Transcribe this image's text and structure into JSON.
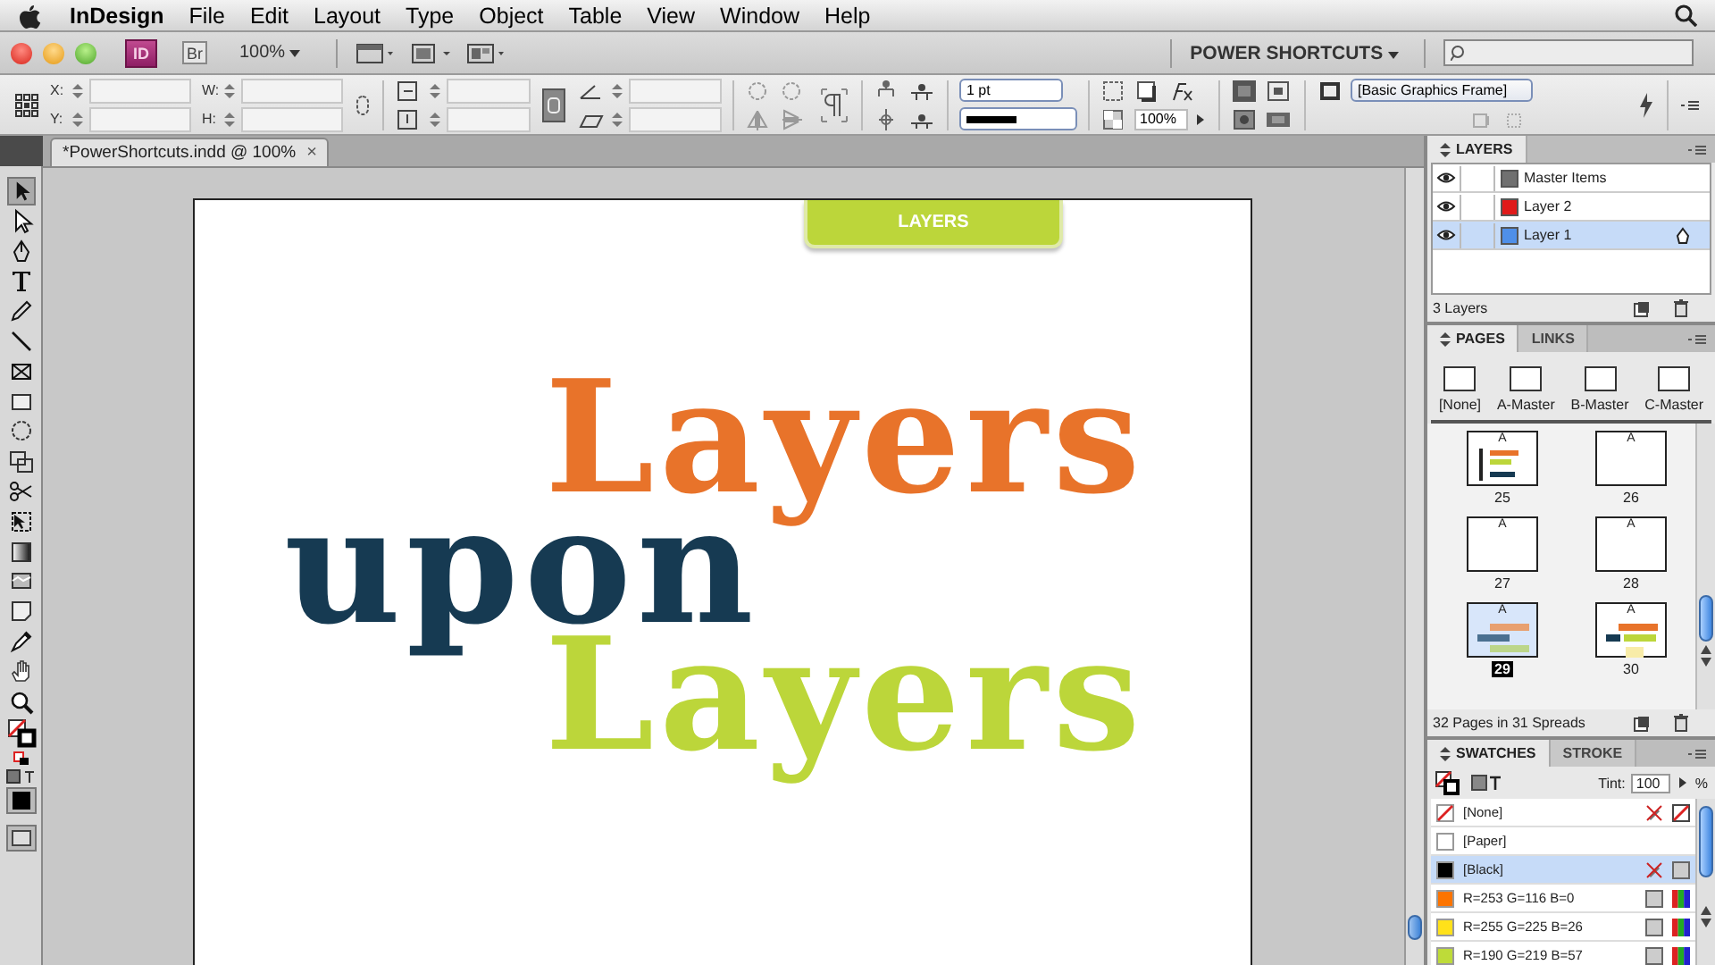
{
  "menu_bar": {
    "app": "InDesign",
    "items": [
      "File",
      "Edit",
      "Layout",
      "Type",
      "Object",
      "Table",
      "View",
      "Window",
      "Help"
    ]
  },
  "app_bar": {
    "app_badge": "ID",
    "bridge_button": "Br",
    "zoom": "100%",
    "workspace": "POWER SHORTCUTS"
  },
  "control_panel": {
    "labels": [
      "X:",
      "Y:",
      "W:",
      "H:"
    ],
    "stroke_weight": "1 pt",
    "opacity": "100%",
    "object_style": "[Basic Graphics Frame]"
  },
  "document_tab": {
    "title": "*PowerShortcuts.indd @ 100%",
    "close": "×"
  },
  "page": {
    "tab_label": "LAYERS",
    "lines": [
      {
        "text": "Layers",
        "color": "#e8732a"
      },
      {
        "text": "upon",
        "color": "#163a52"
      },
      {
        "text": "Layers",
        "color": "#bcd63a"
      }
    ]
  },
  "layers_panel": {
    "tabs": [
      {
        "label": "LAYERS",
        "selected": true
      }
    ],
    "layers": [
      {
        "name": "Master Items",
        "color": "#707070",
        "visible": true,
        "selected": false
      },
      {
        "name": "Layer 2",
        "color": "#e01a1a",
        "visible": true,
        "selected": false
      },
      {
        "name": "Layer 1",
        "color": "#4f8fe8",
        "visible": true,
        "selected": true
      }
    ],
    "footer": "3 Layers"
  },
  "pages_panel": {
    "tabs": [
      {
        "label": "PAGES",
        "selected": true
      },
      {
        "label": "LINKS",
        "selected": false
      }
    ],
    "masters": [
      "[None]",
      "A-Master",
      "B-Master",
      "C-Master"
    ],
    "pages": [
      {
        "number": "25",
        "master": "A",
        "kind": "collage",
        "selected": false
      },
      {
        "number": "26",
        "master": "A",
        "kind": "blank",
        "selected": false
      },
      {
        "number": "27",
        "master": "A",
        "kind": "blank",
        "selected": false
      },
      {
        "number": "28",
        "master": "A",
        "kind": "blank",
        "selected": false
      },
      {
        "number": "29",
        "master": "A",
        "kind": "layers",
        "selected": true
      },
      {
        "number": "30",
        "master": "A",
        "kind": "notes",
        "selected": false
      }
    ],
    "footer": "32 Pages in 31 Spreads"
  },
  "swatches_panel": {
    "tabs": [
      {
        "label": "SWATCHES",
        "selected": true
      },
      {
        "label": "STROKE",
        "selected": false
      }
    ],
    "tint_label": "Tint:",
    "tint": "100",
    "percent": "%",
    "swatches": [
      {
        "name": "[None]",
        "kind": "none",
        "locked": true,
        "selected": false
      },
      {
        "name": "[Paper]",
        "kind": "paper",
        "color": "#ffffff",
        "locked": false,
        "selected": false
      },
      {
        "name": "[Black]",
        "kind": "black",
        "color": "#000000",
        "locked": true,
        "selected": true
      },
      {
        "name": "R=253 G=116 B=0",
        "kind": "rgb",
        "color": "#fd7400",
        "locked": false,
        "selected": false
      },
      {
        "name": "R=255 G=225 B=26",
        "kind": "rgb",
        "color": "#ffe11a",
        "locked": false,
        "selected": false
      },
      {
        "name": "R=190 G=219 B=57",
        "kind": "rgb",
        "color": "#bedb39",
        "locked": false,
        "selected": false
      }
    ]
  }
}
